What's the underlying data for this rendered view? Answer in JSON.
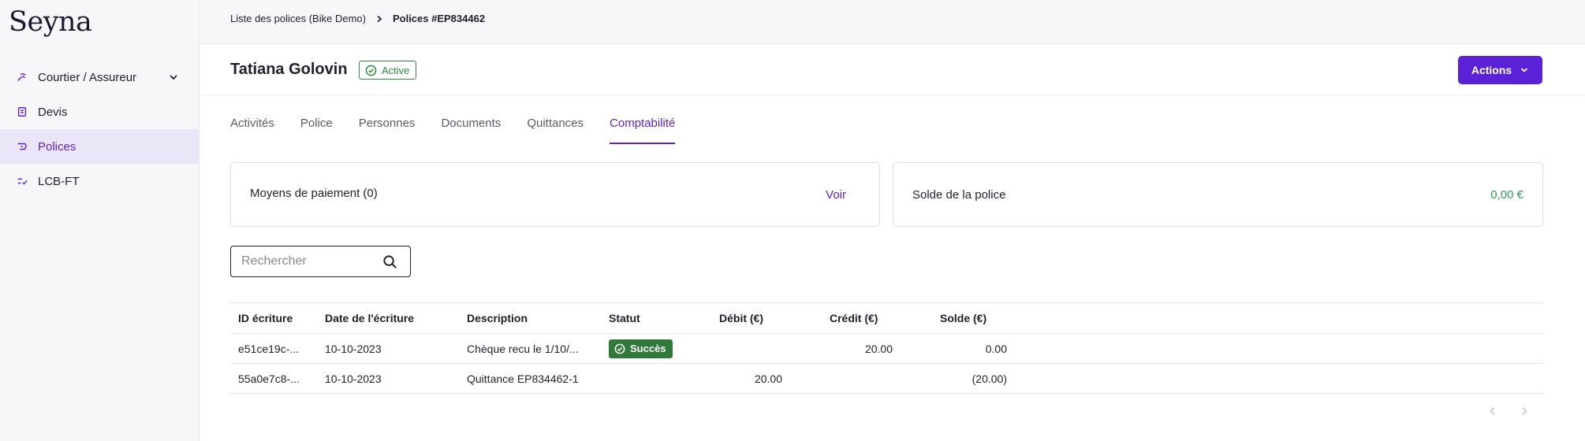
{
  "app": {
    "logo": "Seyna"
  },
  "sidebar": {
    "items": [
      {
        "label": "Courtier / Assureur",
        "icon": "broker-icon",
        "expandable": true,
        "active": false
      },
      {
        "label": "Devis",
        "icon": "document-icon",
        "active": false
      },
      {
        "label": "Polices",
        "icon": "policy-icon",
        "active": true
      },
      {
        "label": "LCB-FT",
        "icon": "checklist-icon",
        "active": false
      }
    ]
  },
  "breadcrumb": {
    "parent": "Liste des polices (Bike Demo)",
    "current": "Polices #EP834462"
  },
  "header": {
    "title": "Tatiana Golovin",
    "status": "Active",
    "actions_label": "Actions"
  },
  "tabs": [
    {
      "label": "Activités",
      "active": false
    },
    {
      "label": "Police",
      "active": false
    },
    {
      "label": "Personnes",
      "active": false
    },
    {
      "label": "Documents",
      "active": false
    },
    {
      "label": "Quittances",
      "active": false
    },
    {
      "label": "Comptabilité",
      "active": true
    }
  ],
  "cards": {
    "payment": {
      "label": "Moyens de paiement (0)",
      "link": "Voir"
    },
    "balance": {
      "label": "Solde de la police",
      "value": "0,00 €"
    }
  },
  "search": {
    "placeholder": "Rechercher",
    "value": ""
  },
  "table": {
    "columns": [
      "ID écriture",
      "Date de l'écriture",
      "Description",
      "Statut",
      "Débit (€)",
      "Crédit (€)",
      "Solde (€)"
    ],
    "rows": [
      {
        "id": "e51ce19c-...",
        "date": "10-10-2023",
        "description": "Chèque recu le 1/10/...",
        "status": "Succès",
        "debit": "",
        "credit": "20.00",
        "solde": "0.00"
      },
      {
        "id": "55a0e7c8-...",
        "date": "10-10-2023",
        "description": "Quittance EP834462-1",
        "status": "",
        "debit": "20.00",
        "credit": "",
        "solde": "(20.00)"
      }
    ]
  },
  "colors": {
    "accent": "#5b21d6",
    "success": "#2f7a3a",
    "positive_amount": "#2f9a54"
  }
}
